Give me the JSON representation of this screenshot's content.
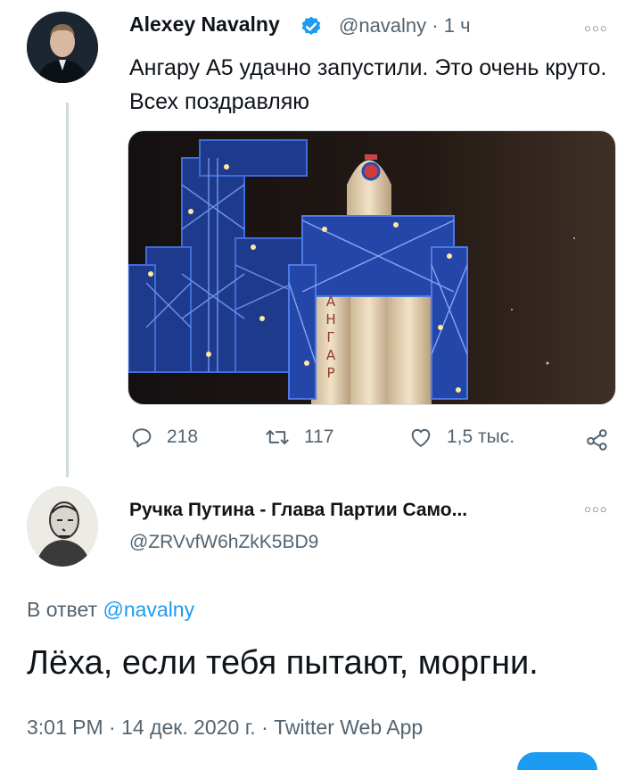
{
  "original_tweet": {
    "author_name": "Alexey Navalny",
    "handle": "@navalny",
    "separator": "·",
    "time": "1 ч",
    "text": "Ангару А5 удачно запустили. Это очень круто. Всех поздравляю",
    "media_lettering": [
      "А",
      "Н",
      "Г",
      "А",
      "Р"
    ],
    "replies": "218",
    "retweets": "117",
    "likes": "1,5 тыс."
  },
  "reply_tweet": {
    "author_name": "Ручка Путина - Глава Партии Само...",
    "handle": "@ZRVvfW6hZkK5BD9",
    "reply_to_prefix": "В ответ",
    "reply_to_handle": "@navalny",
    "text": "Лёха, если тебя пытают, моргни.",
    "time": "3:01 PM",
    "date": "14 дек. 2020 г.",
    "source": "Twitter Web App",
    "dot": "·"
  },
  "icons": {
    "more": "more-icon",
    "reply": "reply-icon",
    "retweet": "retweet-icon",
    "like": "like-icon",
    "share": "share-icon",
    "verified": "verified-badge-icon"
  },
  "colors": {
    "accent": "#1d9bf0",
    "secondary_text": "#536471",
    "thread_line": "#cfd9de"
  }
}
